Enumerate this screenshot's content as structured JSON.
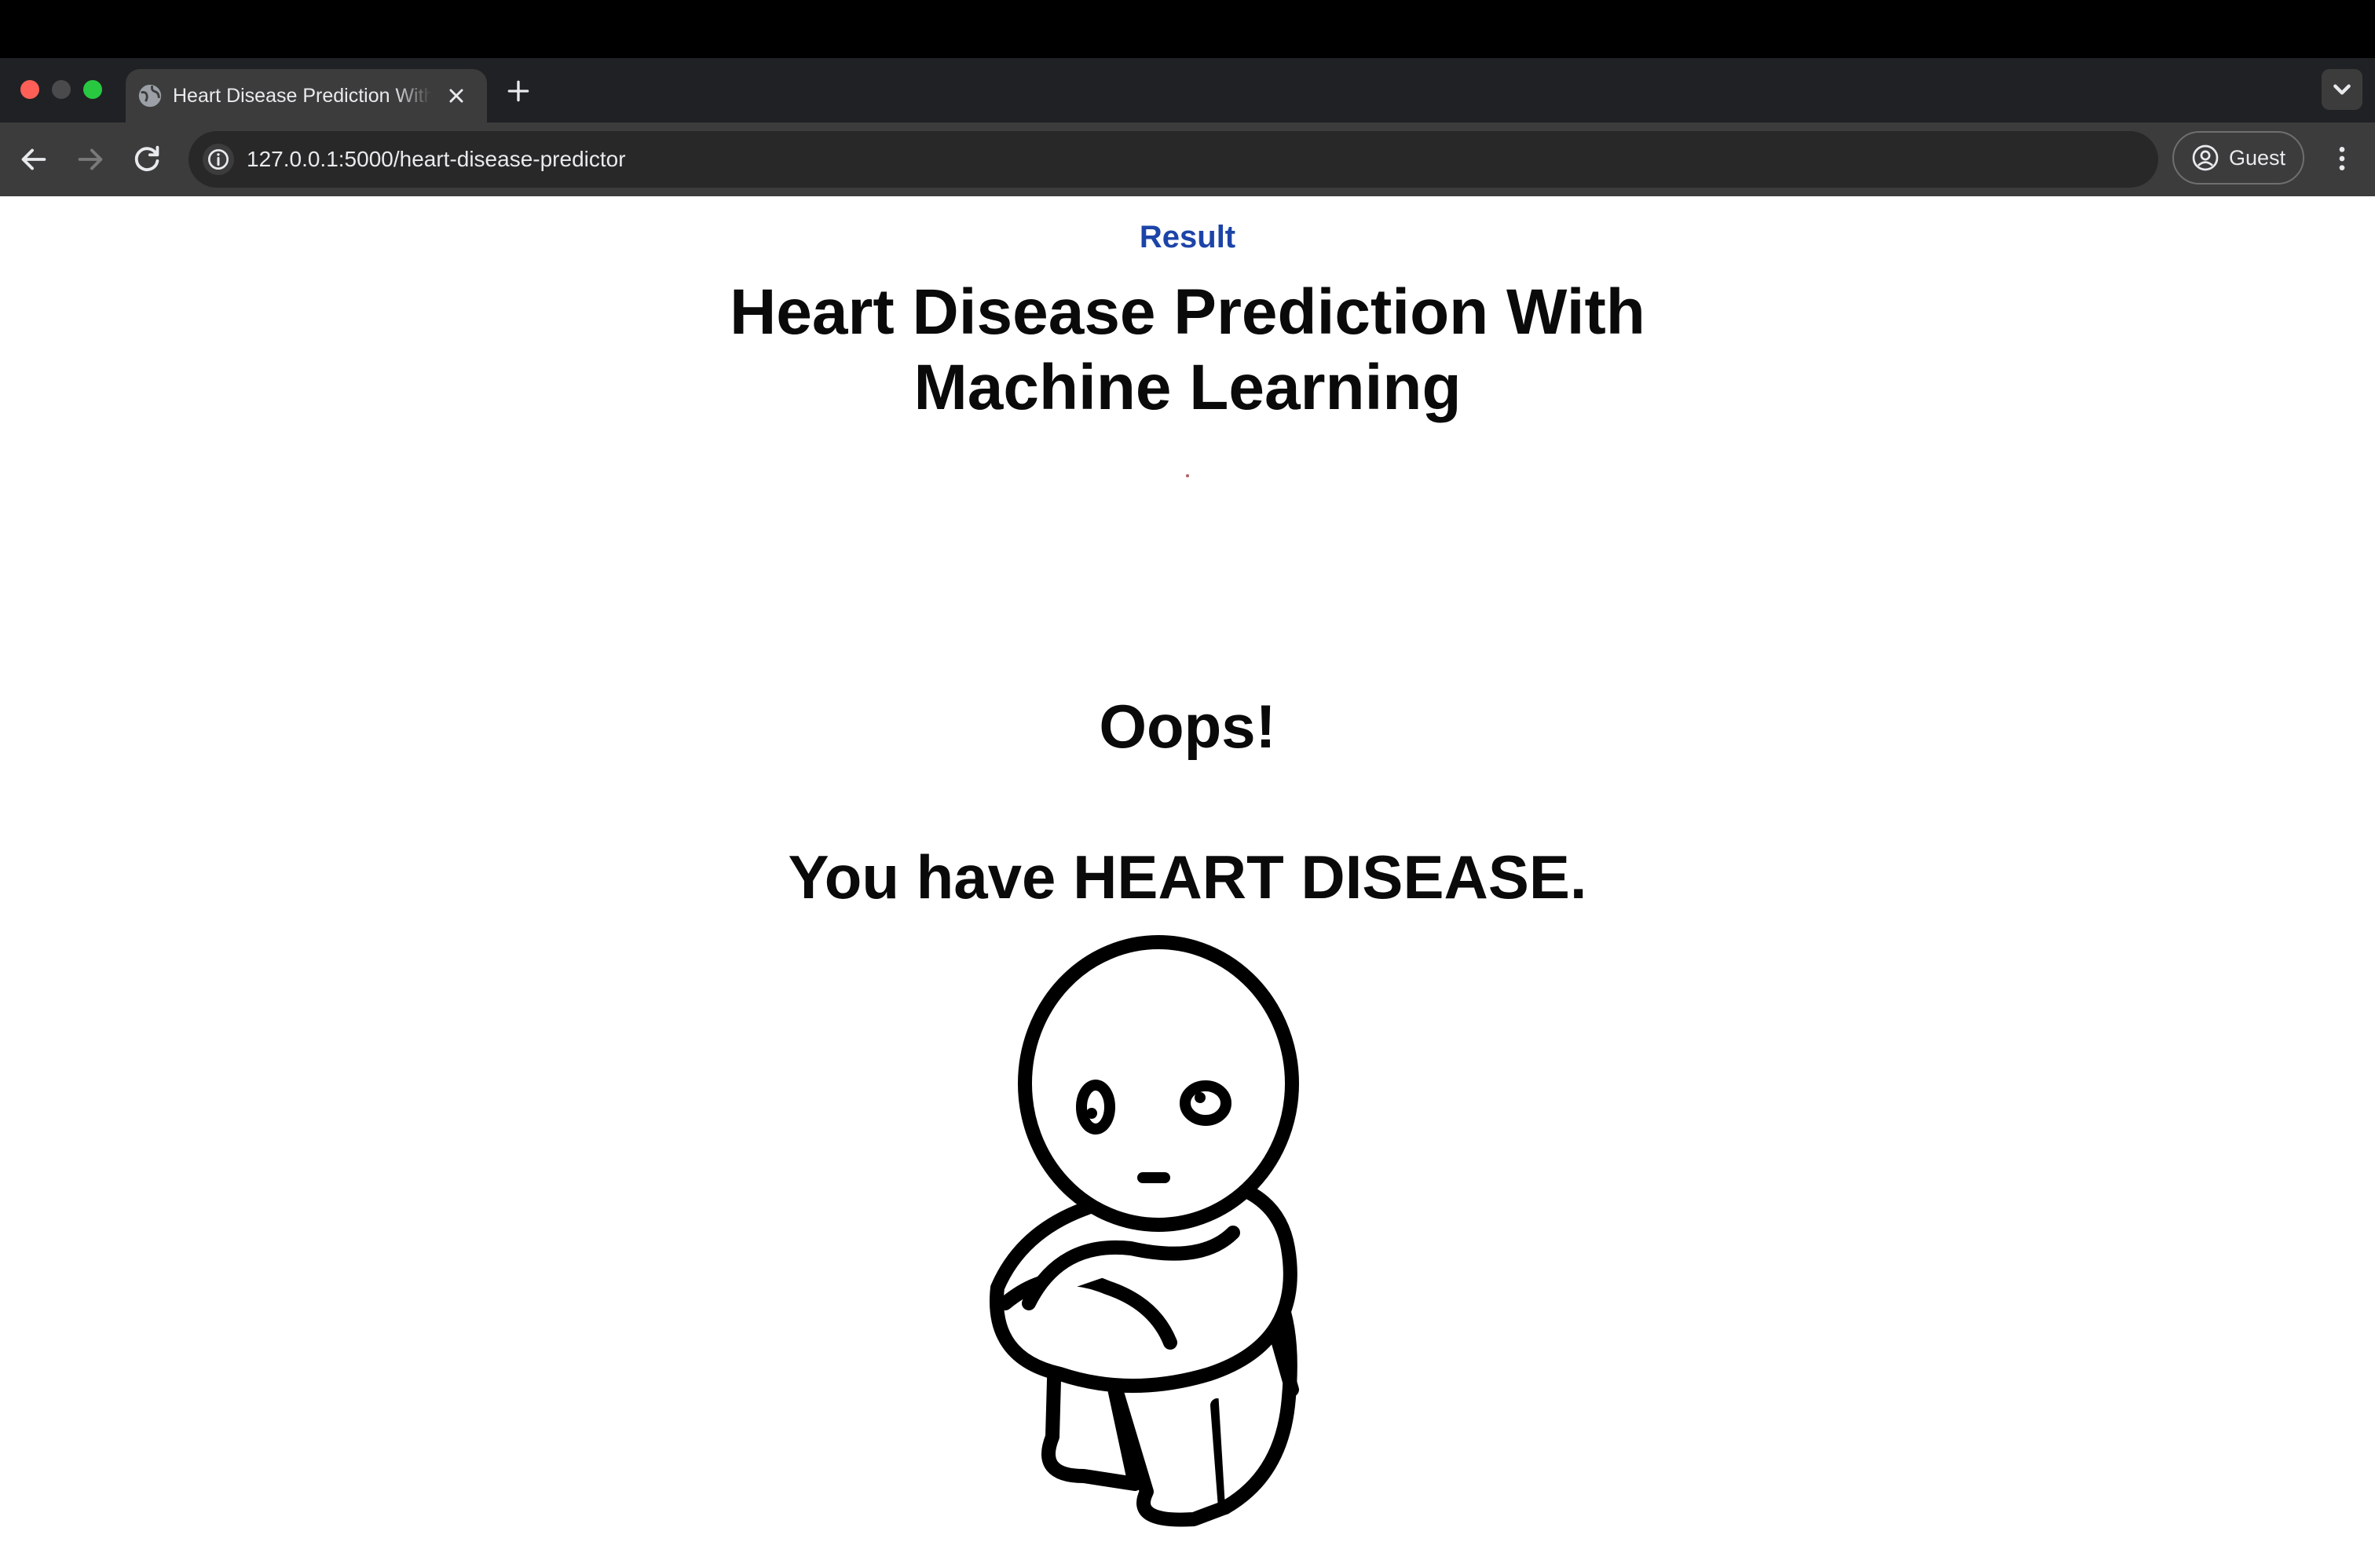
{
  "browser": {
    "tab": {
      "title": "Heart Disease Prediction With Machine Learning",
      "favicon": "globe-icon",
      "close_icon": "close-icon"
    },
    "new_tab_icon": "plus-icon",
    "tab_search_icon": "chevron-down-icon",
    "nav": {
      "back_icon": "arrow-left-icon",
      "forward_icon": "arrow-right-icon",
      "reload_icon": "reload-icon"
    },
    "address_bar": {
      "icon": "info-icon",
      "url": "127.0.0.1:5000/heart-disease-predictor"
    },
    "profile": {
      "icon": "user-circle-icon",
      "label": "Guest"
    },
    "menu_icon": "kebab-menu-icon"
  },
  "page": {
    "section_label": "Result",
    "title": "Heart Disease Prediction With Machine Learning",
    "exclamation": "Oops!",
    "result_message": "You have HEART DISEASE.",
    "illustration": "sad-person-hugging-knees",
    "colors": {
      "accent": "#1c44a8",
      "text": "#0a0a0a",
      "background": "#ffffff"
    }
  }
}
